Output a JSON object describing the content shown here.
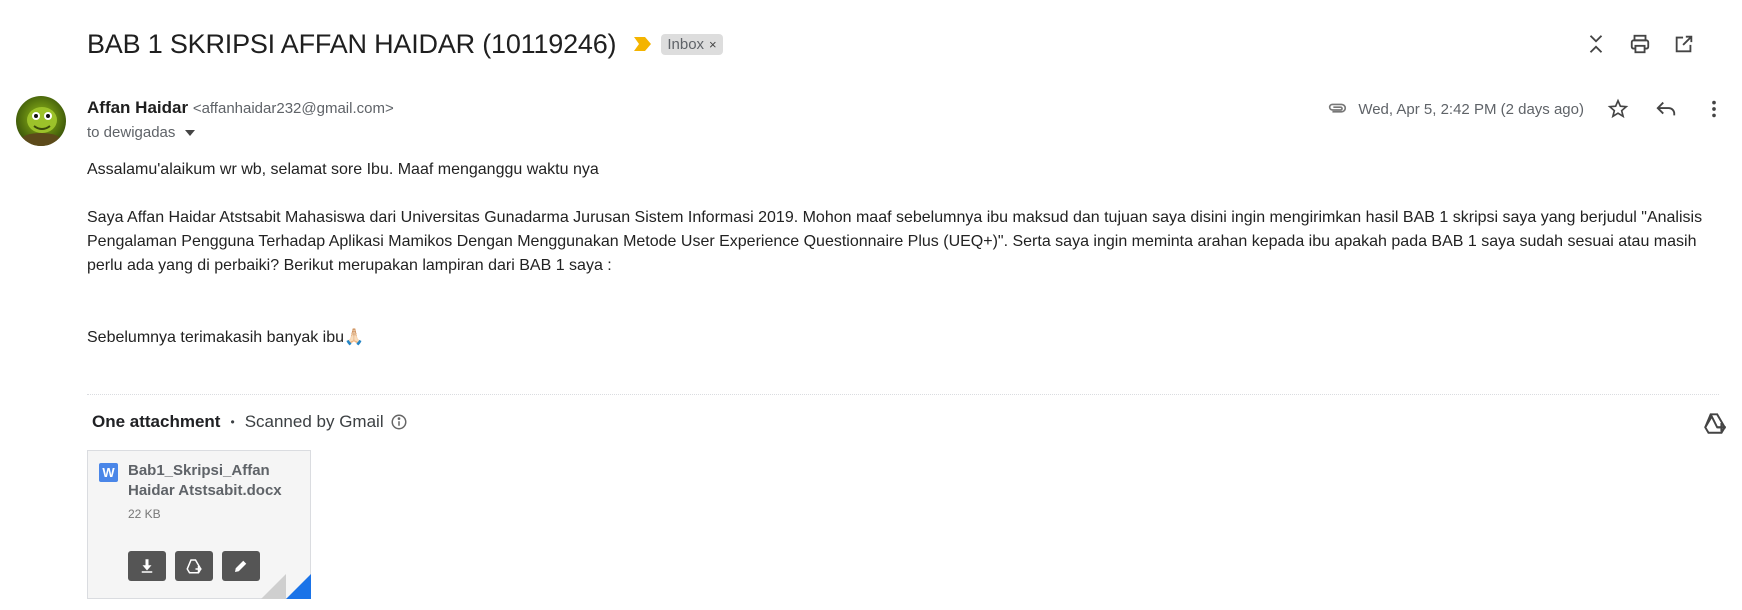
{
  "email": {
    "subject": "BAB 1 SKRIPSI AFFAN HAIDAR (10119246)",
    "label": "Inbox",
    "label_close": "×",
    "sender_name": "Affan Haidar",
    "sender_email": "<affanhaidar232@gmail.com>",
    "recipient": "to dewigadas",
    "date": "Wed, Apr 5, 2:42 PM (2 days ago)"
  },
  "body": {
    "greeting": "Assalamu'alaikum wr wb, selamat sore Ibu. Maaf menganggu waktu nya",
    "paragraph": "Saya Affan Haidar Atstsabit Mahasiswa dari Universitas Gunadarma Jurusan Sistem Informasi 2019. Mohon maaf sebelumnya ibu maksud dan tujuan saya disini ingin mengirimkan hasil BAB 1 skripsi saya yang berjudul \"Analisis Pengalaman Pengguna Terhadap Aplikasi Mamikos Dengan Menggunakan Metode User Experience Questionnaire Plus (UEQ+)\". Serta saya ingin meminta arahan kepada ibu apakah pada BAB 1 saya sudah sesuai atau masih perlu ada yang di perbaiki? Berikut merupakan lampiran dari BAB 1 saya :",
    "closing": "Sebelumnya terimakasih banyak ibu🙏🏻"
  },
  "attachments": {
    "header": "One attachment",
    "separator": "•",
    "scan_note": "Scanned by Gmail",
    "file": {
      "type_letter": "W",
      "name": "Bab1_Skripsi_Affan Haidar Atstsabit.docx",
      "size": "22 KB"
    }
  },
  "colors": {
    "importance": "#f4b400",
    "word_blue": "#4a86e8",
    "corner_blue": "#1a73e8",
    "label_bg": "#dddddd"
  },
  "icons": {
    "top": [
      "collapse-icon",
      "print-icon",
      "open-new-window-icon"
    ],
    "message": [
      "paperclip-icon",
      "star-icon",
      "reply-icon",
      "more-vert-icon"
    ],
    "attachment": [
      "info-icon",
      "add-to-drive-icon",
      "download-icon",
      "edit-icon"
    ]
  }
}
